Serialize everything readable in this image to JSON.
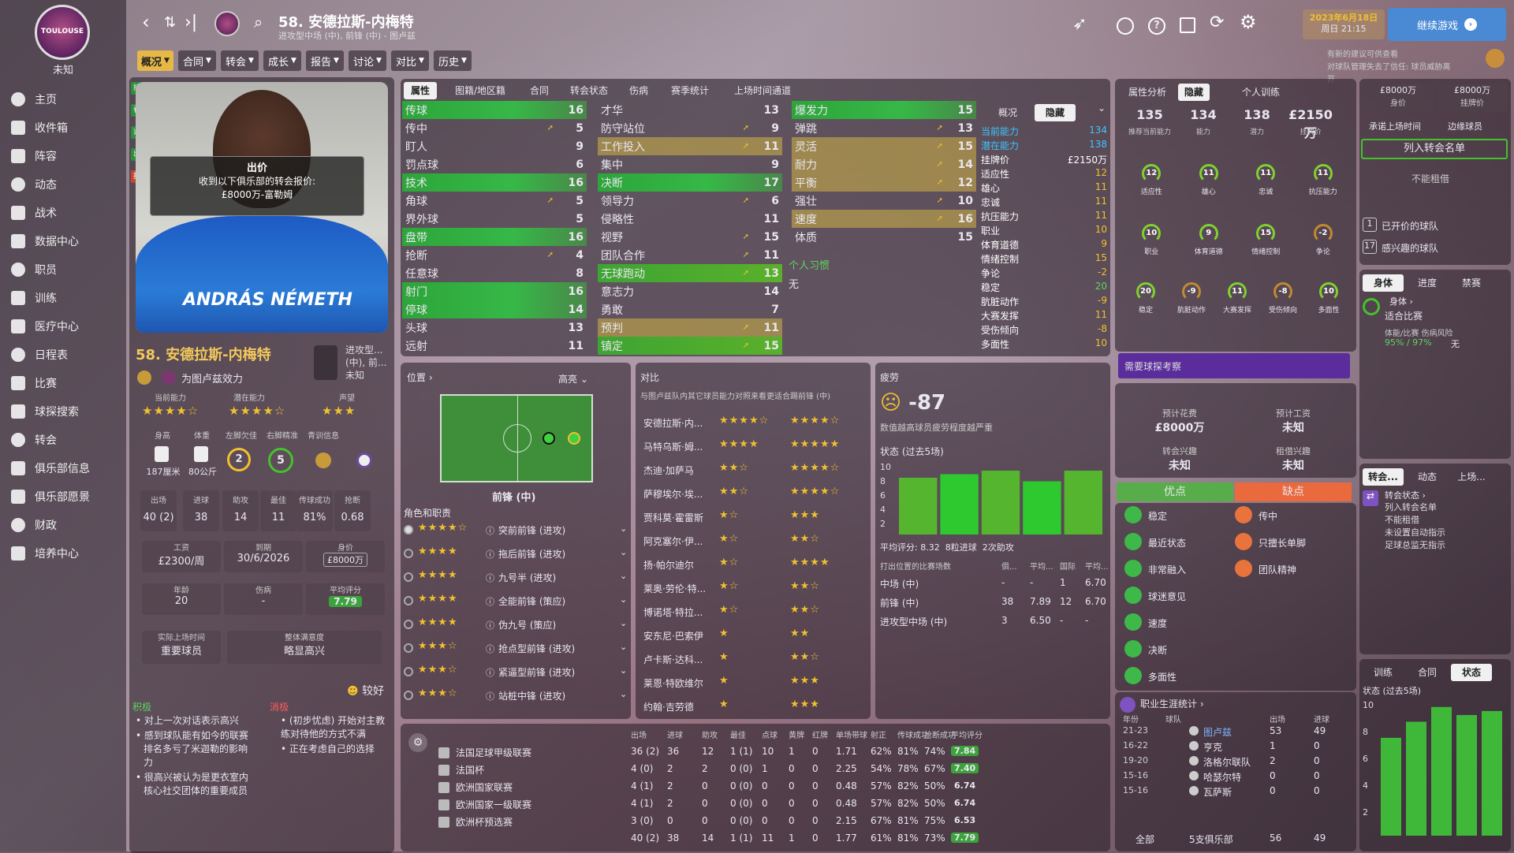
{
  "sidebar": {
    "club_name": "未知",
    "crest_text": "TOULOUSE",
    "items": [
      {
        "label": "主页",
        "icon": "home-icon"
      },
      {
        "label": "收件箱",
        "icon": "inbox-icon"
      },
      {
        "label": "阵容",
        "icon": "squad-icon"
      },
      {
        "label": "动态",
        "icon": "dynamics-icon"
      },
      {
        "label": "战术",
        "icon": "tactics-icon"
      },
      {
        "label": "数据中心",
        "icon": "data-icon"
      },
      {
        "label": "职员",
        "icon": "staff-icon"
      },
      {
        "label": "训练",
        "icon": "training-icon"
      },
      {
        "label": "医疗中心",
        "icon": "medical-icon"
      },
      {
        "label": "日程表",
        "icon": "calendar-icon"
      },
      {
        "label": "比赛",
        "icon": "trophy-icon"
      },
      {
        "label": "球探搜索",
        "icon": "scout-icon"
      },
      {
        "label": "转会",
        "icon": "transfer-icon"
      },
      {
        "label": "俱乐部信息",
        "icon": "club-info-icon"
      },
      {
        "label": "俱乐部愿景",
        "icon": "vision-icon"
      },
      {
        "label": "财政",
        "icon": "finance-icon"
      },
      {
        "label": "培养中心",
        "icon": "development-icon"
      }
    ]
  },
  "topbar": {
    "title": "58. 安德拉斯-内梅特",
    "subtitle": "进攻型中场 (中), 前锋 (中) - 图卢兹",
    "date_line1": "2023年6月18日",
    "date_line2": "周日 21:15",
    "continue_label": "继续游戏",
    "hint_line1": "有新的建议可供查看",
    "hint_line2": "对球队管理失去了信任: 球员威胁离开"
  },
  "player_tabs": [
    "概况",
    "合同",
    "转会",
    "成长",
    "报告",
    "讨论",
    "对比",
    "历史"
  ],
  "profile": {
    "side_chips": [
      "挂牌",
      "看法",
      "兴趣",
      "出价",
      "报价"
    ],
    "offer_title": "出价",
    "offer_line1": "收到以下俱乐部的转会报价:",
    "offer_line2": "£8000万-富勒姆",
    "shirt_text": "ANDRÁS NÉMETH",
    "name": "58. 安德拉斯-内梅特",
    "role": "进攻型... (中), 前... 未知",
    "club_line": "为图卢兹效力",
    "ca_label": "当前能力",
    "pa_label": "潜在能力",
    "rep_label": "声望",
    "ca_stars": "★★★★☆",
    "pa_stars": "★★★★☆",
    "rep_stars": "★★★",
    "stat_labels": [
      "身高",
      "体重",
      "左脚欠佳",
      "右脚精准",
      "青训信息"
    ],
    "height": "187厘米",
    "weight": "80公斤",
    "left_foot": "2",
    "right_foot": "5",
    "apps_labels": [
      "出场",
      "进球",
      "助攻",
      "最佳",
      "传球成功",
      "抢断"
    ],
    "apps_values": [
      "40 (2)",
      "38",
      "14",
      "11",
      "81%",
      "0.68"
    ],
    "wage_label": "工资",
    "wage": "£2300/周",
    "expires_label": "到期",
    "expires": "30/6/2026",
    "value_label": "身价",
    "value": "£8000万",
    "age_label": "年龄",
    "age": "20",
    "injury_label": "伤病",
    "injury": "-",
    "rating_label": "平均评分",
    "rating": "7.79",
    "status_label": "实际上场时间",
    "status": "重要球员",
    "happiness_label": "整体满意度",
    "happiness": "略显高兴",
    "mood_label": "较好",
    "pos_title": "积极",
    "pos_items": [
      "对上一次对话表示高兴",
      "感到球队能有如今的联赛排名多亏了米迦勒的影响力",
      "很高兴被认为是更衣室内核心社交团体的重要成员"
    ],
    "neg_title": "消极",
    "neg_items": [
      "(初步忧虑) 开始对主教练对待他的方式不满",
      "正在考虑自己的选择"
    ]
  },
  "attr_tabs": [
    "属性",
    "图籍/地区籍",
    "合同",
    "转会状态",
    "伤病",
    "赛季统计",
    "上场时间通道"
  ],
  "attributes": {
    "technical": [
      {
        "n": "传球",
        "v": "16",
        "s": "hl"
      },
      {
        "n": "传中",
        "v": "5",
        "s": "arr"
      },
      {
        "n": "盯人",
        "v": "9",
        "s": ""
      },
      {
        "n": "罚点球",
        "v": "6",
        "s": ""
      },
      {
        "n": "技术",
        "v": "16",
        "s": "hl"
      },
      {
        "n": "角球",
        "v": "5",
        "s": "arr"
      },
      {
        "n": "界外球",
        "v": "5",
        "s": ""
      },
      {
        "n": "盘带",
        "v": "16",
        "s": "hl"
      },
      {
        "n": "抢断",
        "v": "4",
        "s": "arr"
      },
      {
        "n": "任意球",
        "v": "8",
        "s": ""
      },
      {
        "n": "射门",
        "v": "16",
        "s": "hl"
      },
      {
        "n": "停球",
        "v": "14",
        "s": "hl"
      },
      {
        "n": "头球",
        "v": "13",
        "s": ""
      },
      {
        "n": "远射",
        "v": "11",
        "s": ""
      }
    ],
    "mental": [
      {
        "n": "才华",
        "v": "13",
        "s": ""
      },
      {
        "n": "防守站位",
        "v": "9",
        "s": "arr"
      },
      {
        "n": "工作投入",
        "v": "11",
        "s": "yl"
      },
      {
        "n": "集中",
        "v": "9",
        "s": ""
      },
      {
        "n": "决断",
        "v": "17",
        "s": "hl"
      },
      {
        "n": "领导力",
        "v": "6",
        "s": "arr"
      },
      {
        "n": "侵略性",
        "v": "11",
        "s": ""
      },
      {
        "n": "视野",
        "v": "15",
        "s": "arr"
      },
      {
        "n": "团队合作",
        "v": "11",
        "s": "arr"
      },
      {
        "n": "无球跑动",
        "v": "13",
        "s": "hl2"
      },
      {
        "n": "意志力",
        "v": "14",
        "s": ""
      },
      {
        "n": "勇敢",
        "v": "7",
        "s": ""
      },
      {
        "n": "预判",
        "v": "11",
        "s": "yl"
      },
      {
        "n": "镇定",
        "v": "15",
        "s": "hl2"
      }
    ],
    "physical": [
      {
        "n": "爆发力",
        "v": "15",
        "s": "hl"
      },
      {
        "n": "弹跳",
        "v": "13",
        "s": "arr"
      },
      {
        "n": "灵活",
        "v": "15",
        "s": "yl"
      },
      {
        "n": "耐力",
        "v": "14",
        "s": "yl"
      },
      {
        "n": "平衡",
        "v": "12",
        "s": "yl"
      },
      {
        "n": "强壮",
        "v": "10",
        "s": "arr"
      },
      {
        "n": "速度",
        "v": "16",
        "s": "yl"
      },
      {
        "n": "体质",
        "v": "15",
        "s": ""
      }
    ],
    "habits_label": "个人习惯",
    "habits_value": "无"
  },
  "overview_tab": {
    "tabs": [
      "概况",
      "隐藏"
    ],
    "rows": [
      {
        "n": "当前能力",
        "v": "134",
        "c": "#3cc6ff"
      },
      {
        "n": "潜在能力",
        "v": "138",
        "c": "#3cc6ff"
      },
      {
        "n": "挂牌价",
        "v": "£2150万",
        "c": "#fff"
      },
      {
        "n": "适应性",
        "v": "12",
        "c": "#f0c030"
      },
      {
        "n": "雄心",
        "v": "11",
        "c": "#f0c030"
      },
      {
        "n": "忠诚",
        "v": "11",
        "c": "#f0c030"
      },
      {
        "n": "抗压能力",
        "v": "11",
        "c": "#f0c030"
      },
      {
        "n": "职业",
        "v": "10",
        "c": "#f0c030"
      },
      {
        "n": "体育道德",
        "v": "9",
        "c": "#f0c030"
      },
      {
        "n": "情绪控制",
        "v": "15",
        "c": "#f0c030"
      },
      {
        "n": "争论",
        "v": "-2",
        "c": "#f0c030"
      },
      {
        "n": "稳定",
        "v": "20",
        "c": "#5fd35f"
      },
      {
        "n": "肮脏动作",
        "v": "-9",
        "c": "#f0c030"
      },
      {
        "n": "大赛发挥",
        "v": "11",
        "c": "#f0c030"
      },
      {
        "n": "受伤倾向",
        "v": "-8",
        "c": "#f0c030"
      },
      {
        "n": "多面性",
        "v": "10",
        "c": "#f0c030"
      }
    ]
  },
  "position": {
    "title": "位置",
    "dropdown": "高亮",
    "label": "前锋 (中)",
    "roles_title": "角色和职责",
    "roles": [
      {
        "stars": "★★★★☆",
        "n": "突前前锋 (进攻)"
      },
      {
        "stars": "★★★★",
        "n": "拖后前锋 (进攻)"
      },
      {
        "stars": "★★★★",
        "n": "九号半 (进攻)"
      },
      {
        "stars": "★★★★",
        "n": "全能前锋 (策应)"
      },
      {
        "stars": "★★★★",
        "n": "伪九号 (策应)"
      },
      {
        "stars": "★★★☆",
        "n": "抢点型前锋 (进攻)"
      },
      {
        "stars": "★★★☆",
        "n": "紧逼型前锋 (进攻)"
      },
      {
        "stars": "★★★☆",
        "n": "站桩中锋 (进攻)"
      }
    ]
  },
  "compare": {
    "title": "对比",
    "desc": "与图卢兹队内其它球员能力对照来看更适合踢前锋 (中)",
    "rows": [
      {
        "n": "安德拉斯·内...",
        "a": "★★★★☆",
        "b": "★★★★☆"
      },
      {
        "n": "马特乌斯·姆...",
        "a": "★★★★",
        "b": "★★★★★"
      },
      {
        "n": "杰迪·加萨马",
        "a": "★★☆",
        "b": "★★★★☆"
      },
      {
        "n": "萨穆埃尔·埃...",
        "a": "★★☆",
        "b": "★★★★☆"
      },
      {
        "n": "贾科莫·霍雷斯",
        "a": "★☆",
        "b": "★★★"
      },
      {
        "n": "阿克塞尔·伊...",
        "a": "★☆",
        "b": "★★☆"
      },
      {
        "n": "扬·帕尔迪尔",
        "a": "★☆",
        "b": "★★★★"
      },
      {
        "n": "莱奥·劳伦·特...",
        "a": "★☆",
        "b": "★★☆"
      },
      {
        "n": "博诺塔·特拉...",
        "a": "★☆",
        "b": "★★☆"
      },
      {
        "n": "安东尼·巴索伊",
        "a": "★",
        "b": "★★"
      },
      {
        "n": "卢卡斯·达科...",
        "a": "★",
        "b": "★★☆"
      },
      {
        "n": "莱恩·特欧维尔",
        "a": "★",
        "b": "★★★"
      },
      {
        "n": "约翰·吉劳德",
        "a": "★",
        "b": "★★★"
      }
    ]
  },
  "form": {
    "title": "疲劳",
    "value": "-87",
    "note": "数值越高球员疲劳程度越严重",
    "chart_title": "状态 (过去5场)",
    "chart_data": {
      "type": "bar",
      "values": [
        8,
        8.5,
        9,
        7.5,
        9
      ],
      "ylim": [
        0,
        10
      ],
      "yticks": [
        "10",
        "8",
        "6",
        "4",
        "2"
      ]
    },
    "avg": "平均评分: 8.32",
    "goals": "8粒进球",
    "assists": "2次助攻",
    "table_headers": [
      "打出位置的比赛场数",
      "俱...",
      "平均...",
      "国际",
      "平均..."
    ],
    "table_rows": [
      {
        "pos": "中场 (中)",
        "a": "-",
        "b": "-",
        "c": "1",
        "d": "6.70"
      },
      {
        "pos": "前锋 (中)",
        "a": "38",
        "b": "7.89",
        "c": "12",
        "d": "6.70"
      },
      {
        "pos": "进攻型中场 (中)",
        "a": "3",
        "b": "6.50",
        "c": "-",
        "d": "-"
      }
    ]
  },
  "stats_table": {
    "headers": [
      "出场",
      "进球",
      "助攻",
      "最佳",
      "点球",
      "黄牌",
      "红牌",
      "单场带球",
      "射正",
      "传球成功",
      "抢断成功",
      "平均评分"
    ],
    "rows": [
      {
        "comp": "法国足球甲级联赛",
        "v": [
          "36 (2)",
          "36",
          "12",
          "1 (1)",
          "10",
          "1",
          "0",
          "1.71",
          "62%",
          "81%",
          "74%"
        ],
        "r": "7.84"
      },
      {
        "comp": "法国杯",
        "v": [
          "4 (0)",
          "2",
          "2",
          "0 (0)",
          "1",
          "0",
          "0",
          "2.25",
          "54%",
          "78%",
          "67%"
        ],
        "r": "7.40"
      },
      {
        "comp": "欧洲国家联赛",
        "v": [
          "4 (1)",
          "2",
          "0",
          "0 (0)",
          "0",
          "0",
          "0",
          "0.48",
          "57%",
          "82%",
          "50%"
        ],
        "r": "6.74"
      },
      {
        "comp": "欧洲国家一级联赛",
        "v": [
          "4 (1)",
          "2",
          "0",
          "0 (0)",
          "0",
          "0",
          "0",
          "0.48",
          "57%",
          "82%",
          "50%"
        ],
        "r": "6.74"
      },
      {
        "comp": "欧洲杯预选赛",
        "v": [
          "3 (0)",
          "0",
          "0",
          "0 (0)",
          "0",
          "0",
          "0",
          "2.15",
          "67%",
          "81%",
          "75%"
        ],
        "r": "6.53"
      }
    ],
    "total": {
      "v": [
        "40 (2)",
        "38",
        "14",
        "1 (1)",
        "11",
        "1",
        "0",
        "1.77",
        "61%",
        "81%",
        "73%"
      ],
      "r": "7.79"
    }
  },
  "analysis": {
    "tabs": [
      "属性分析",
      "隐藏",
      "个人训练"
    ],
    "top_values": [
      {
        "v": "135",
        "l": "推荐当前能力"
      },
      {
        "v": "134",
        "l": "能力"
      },
      {
        "v": "138",
        "l": "潜力"
      },
      {
        "v": "£2150万",
        "l": "挂牌价"
      }
    ],
    "gauges_row1": [
      {
        "v": "12",
        "l": "适应性"
      },
      {
        "v": "11",
        "l": "雄心"
      },
      {
        "v": "11",
        "l": "忠诚"
      },
      {
        "v": "11",
        "l": "抗压能力"
      }
    ],
    "gauges_row2": [
      {
        "v": "10",
        "l": "职业"
      },
      {
        "v": "9",
        "l": "体育道德"
      },
      {
        "v": "15",
        "l": "情绪控制"
      },
      {
        "v": "-2",
        "l": "争论"
      }
    ],
    "gauges_row3": [
      {
        "v": "20",
        "l": "稳定"
      },
      {
        "v": "-9",
        "l": "肮脏动作"
      },
      {
        "v": "11",
        "l": "大赛发挥"
      },
      {
        "v": "-8",
        "l": "受伤倾向"
      },
      {
        "v": "10",
        "l": "多面性"
      }
    ],
    "scout_label": "需要球探考察",
    "fee_label": "预计花费",
    "fee": "£8000万",
    "wage_label": "预计工资",
    "wage": "未知",
    "interest_label": "转会兴趣",
    "interest": "未知",
    "loan_label": "租借兴趣",
    "loan": "未知",
    "pros_label": "优点",
    "cons_label": "缺点",
    "pros": [
      "稳定",
      "最近状态",
      "非常融入",
      "球迷意见",
      "速度",
      "决断",
      "多面性"
    ],
    "cons": [
      "传中",
      "只擅长单脚",
      "团队精神"
    ],
    "career_title": "职业生涯统计",
    "career_headers": [
      "年份",
      "球队",
      "出场",
      "进球"
    ],
    "career_rows": [
      {
        "y": "21-23",
        "c": "图卢兹",
        "a": "53",
        "g": "49"
      },
      {
        "y": "16-22",
        "c": "亨克",
        "a": "1",
        "g": "0"
      },
      {
        "y": "19-20",
        "c": "洛格尔联队",
        "a": "2",
        "g": "0"
      },
      {
        "y": "15-16",
        "c": "哈瑟尔特",
        "a": "0",
        "g": "0"
      },
      {
        "y": "15-16",
        "c": "瓦萨斯",
        "a": "0",
        "g": "0"
      }
    ],
    "career_total": {
      "y": "全部",
      "c": "5支俱乐部",
      "a": "56",
      "g": "49"
    }
  },
  "right": {
    "value_box": "£8000万",
    "value_label": "身价",
    "asking_box": "£8000万",
    "asking_label": "挂牌价",
    "next_match_label": "承诺上场时间",
    "next_match": "边缘球员",
    "add_list_btn": "列入转会名单",
    "no_loan": "不能租借",
    "clubs_opened": "已开价的球队",
    "clubs_opened_n": "1",
    "clubs_interested": "感兴趣的球队",
    "clubs_interested_n": "17",
    "body_tabs": [
      "身体",
      "进度",
      "禁赛"
    ],
    "body_line1": "身体",
    "body_line2": "适合比赛",
    "body_line3": "体能/比赛 伤病风险",
    "body_line4": "95% / 97%",
    "body_risk": "无",
    "transfer_tabs": [
      "转会...",
      "动态",
      "上场..."
    ],
    "transfer_status_title": "转会状态",
    "transfer_status_lines": [
      "列入转会名单",
      "不能租借",
      "未设置自动指示",
      "足球总监无指示"
    ],
    "bottom_tabs": [
      "训练",
      "合同",
      "状态"
    ],
    "form_title": "状态 (过去5场)",
    "chart_data": {
      "type": "bar",
      "values": [
        7.3,
        8.5,
        9.6,
        9,
        9.3
      ],
      "ylim": [
        0,
        10
      ],
      "yticks": [
        "10",
        "8",
        "6",
        "4",
        "2"
      ]
    }
  }
}
